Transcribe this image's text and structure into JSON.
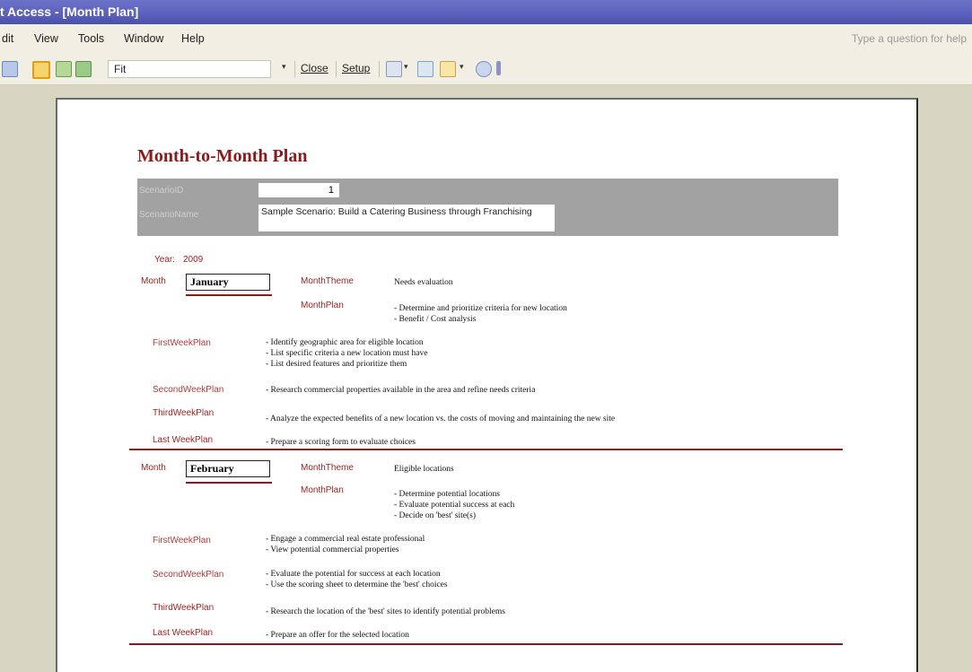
{
  "window": {
    "title": "t Access - [Month Plan]"
  },
  "menu": {
    "items": [
      "dit",
      "View",
      "Tools",
      "Window",
      "Help"
    ],
    "help_placeholder": "Type a question for help"
  },
  "toolbar": {
    "zoom_value": "Fit",
    "close_label": "Close",
    "setup_label": "Setup",
    "dropdown_glyph": "▾"
  },
  "report": {
    "title": "Month-to-Month Plan",
    "scenario_id_label": "ScenarioID",
    "scenario_id": "1",
    "scenario_name_label": "ScenarioName",
    "scenario_name": "Sample Scenario:  Build a Catering Business through Franchising",
    "year_label": "Year:",
    "year": "2009",
    "labels": {
      "month": "Month",
      "month_theme": "MonthTheme",
      "month_plan": "MonthPlan",
      "week1": "FirstWeekPlan",
      "week2": "SecondWeekPlan",
      "week3": "ThirdWeekPlan",
      "week4": "Last WeekPlan"
    },
    "months": [
      {
        "month": "January",
        "theme": "Needs evaluation",
        "plan": [
          "- Determine and prioritize criteria for new location",
          "- Benefit / Cost analysis"
        ],
        "week1": [
          "- Identify geographic area for eligible location",
          "- List specific criteria a new location must have",
          "- List desired features and prioritize them"
        ],
        "week2": [
          "- Research commercial properties available in the area and refine needs criteria"
        ],
        "week3": [
          "- Analyze the expected benefits of a new location vs. the costs of moving and maintaining the new site"
        ],
        "week4": [
          "- Prepare a scoring form to evaluate choices"
        ]
      },
      {
        "month": "February",
        "theme": "Eligible locations",
        "plan": [
          "- Determine potential locations",
          "- Evaluate potential success at each",
          "- Decide on 'best' site(s)"
        ],
        "week1": [
          "- Engage a commercial real estate professional",
          "- View potential commercial properties"
        ],
        "week2": [
          "- Evaluate the potential for success at each location",
          "- Use the scoring sheet to determine the 'best' choices"
        ],
        "week3": [
          "- Research the location of the 'best' sites to identify potential problems"
        ],
        "week4": [
          "- Prepare an offer for the selected location"
        ]
      }
    ]
  },
  "colors": {
    "title_bar": "#5b60bb",
    "accent": "#8b1a1a",
    "header_band": "#a2a2a2",
    "app_bg": "#d8d6c3"
  }
}
